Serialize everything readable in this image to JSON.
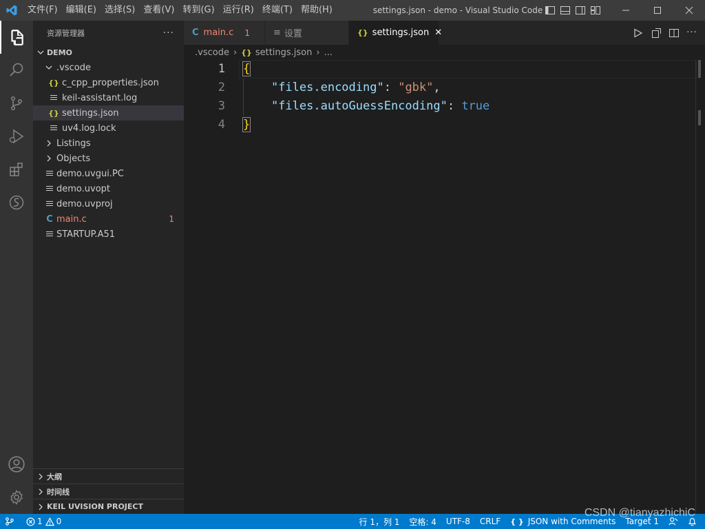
{
  "window": {
    "title": "settings.json - demo - Visual Studio Code"
  },
  "menu": [
    "文件(F)",
    "编辑(E)",
    "选择(S)",
    "查看(V)",
    "转到(G)",
    "运行(R)",
    "终端(T)",
    "帮助(H)"
  ],
  "activity_bar": {
    "items": [
      "explorer-icon",
      "search-icon",
      "source-control-icon",
      "run-debug-icon",
      "extensions-icon",
      "keil-extension-icon"
    ],
    "bottom": [
      "account-icon",
      "settings-gear-icon"
    ]
  },
  "sidebar": {
    "title": "资源管理器",
    "more": "···",
    "root": "DEMO",
    "tree": [
      {
        "label": ".vscode",
        "type": "folder",
        "open": true
      },
      {
        "label": "c_cpp_properties.json",
        "type": "json"
      },
      {
        "label": "keil-assistant.log",
        "type": "text"
      },
      {
        "label": "settings.json",
        "type": "json",
        "selected": true
      },
      {
        "label": "uv4.log.lock",
        "type": "text"
      },
      {
        "label": "Listings",
        "type": "folder",
        "open": false
      },
      {
        "label": "Objects",
        "type": "folder",
        "open": false
      },
      {
        "label": "demo.uvgui.PC",
        "type": "text"
      },
      {
        "label": "demo.uvopt",
        "type": "text"
      },
      {
        "label": "demo.uvproj",
        "type": "text"
      },
      {
        "label": "main.c",
        "type": "c",
        "problems": "1"
      },
      {
        "label": "STARTUP.A51",
        "type": "text"
      }
    ],
    "sections": [
      "大纲",
      "时间线",
      "KEIL UVISION PROJECT"
    ]
  },
  "tabs": [
    {
      "label": "main.c",
      "icon": "C",
      "badge": "1",
      "active": false
    },
    {
      "label": "设置",
      "icon": "≡",
      "active": false
    },
    {
      "label": "settings.json",
      "icon": "{}",
      "active": true,
      "close": "✕"
    }
  ],
  "breadcrumb": {
    "folder": ".vscode",
    "file": "settings.json",
    "more": "..."
  },
  "editor": {
    "line_numbers": [
      "1",
      "2",
      "3",
      "4"
    ],
    "lines": [
      {
        "open_brace": "{"
      },
      {
        "key": "\"files.encoding\"",
        "colon": ": ",
        "value": "\"gbk\"",
        "comma": ","
      },
      {
        "key": "\"files.autoGuessEncoding\"",
        "colon": ": ",
        "value": "true"
      },
      {
        "close_brace": "}"
      }
    ]
  },
  "status_bar": {
    "remote_icon": "remote-icon",
    "errors": "1",
    "warnings": "0",
    "position": "行 1，列 1",
    "spaces": "空格: 4",
    "encoding": "UTF-8",
    "eol": "CRLF",
    "language": "JSON with Comments",
    "target": "Target 1"
  },
  "watermark": "CSDN @tianyazhichiC",
  "colors": {
    "accent": "#007acc",
    "json_key": "#9cdcfe",
    "json_string": "#ce9178",
    "json_bool": "#569cd6",
    "brace": "#ffd700",
    "error_red": "#f48771"
  }
}
